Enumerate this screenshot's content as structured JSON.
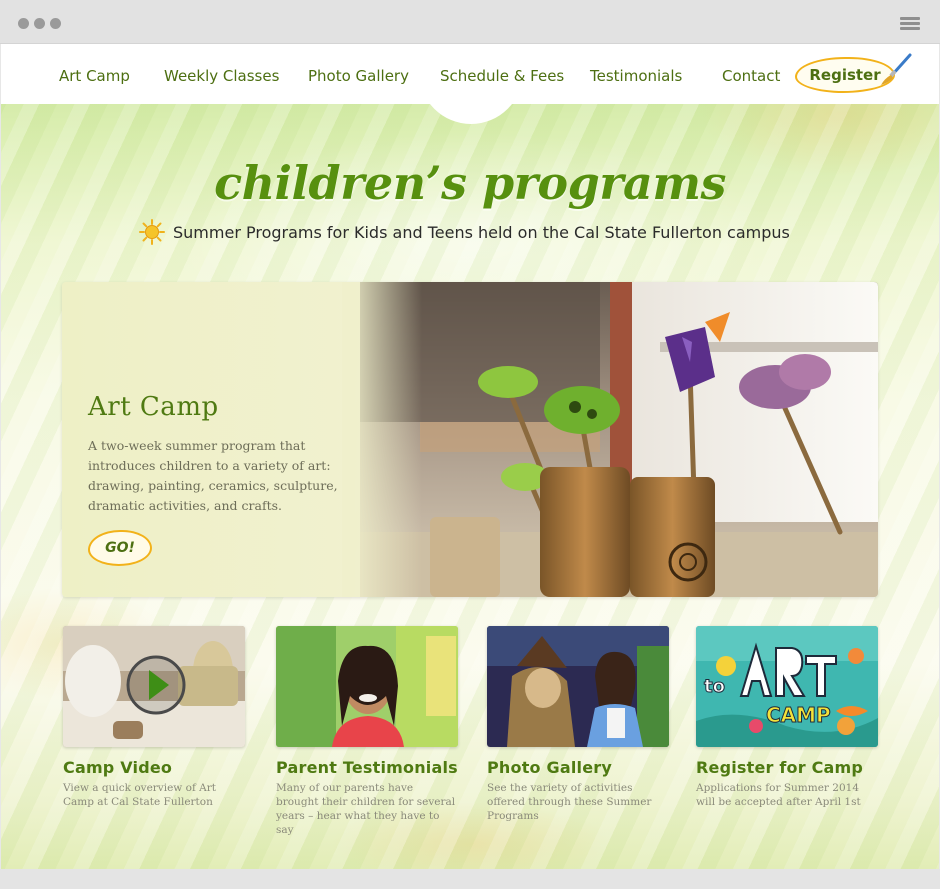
{
  "nav": {
    "items": [
      {
        "label": "Art Camp"
      },
      {
        "label": "Weekly Classes"
      },
      {
        "label": "Photo Gallery"
      },
      {
        "label": "Schedule & Fees"
      },
      {
        "label": "Testimonials"
      },
      {
        "label": "Contact"
      }
    ],
    "register_label": "Register"
  },
  "hero": {
    "title": "children’s programs",
    "tagline": "Summer Programs for Kids and Teens held on the Cal State Fullerton campus"
  },
  "feature": {
    "title": "Art Camp",
    "description": "A two-week summer program that introduces children to a variety of art: drawing, painting, ceramics, sculpture, dramatic activities, and crafts.",
    "go_label": "GO!"
  },
  "cards": [
    {
      "title": "Camp Video",
      "desc": "View a quick overview of Art Camp at Cal State Fullerton"
    },
    {
      "title": "Parent Testimonials",
      "desc": "Many of our parents have brought their children for several years – hear what they have to say"
    },
    {
      "title": "Photo Gallery",
      "desc": "See the variety of activities offered through these Summer Programs"
    },
    {
      "title": "Register for Camp",
      "desc": "Applications for Summer 2014 will be accepted after April 1st"
    }
  ],
  "colors": {
    "accent_green": "#4f7a12",
    "title_green": "#57900f",
    "button_outline": "#f2b21a"
  },
  "icons": {
    "browser_menu": "hamburger-icon",
    "register_decoration": "paintbrush-icon",
    "tagline": "sun-icon",
    "video": "play-icon"
  }
}
